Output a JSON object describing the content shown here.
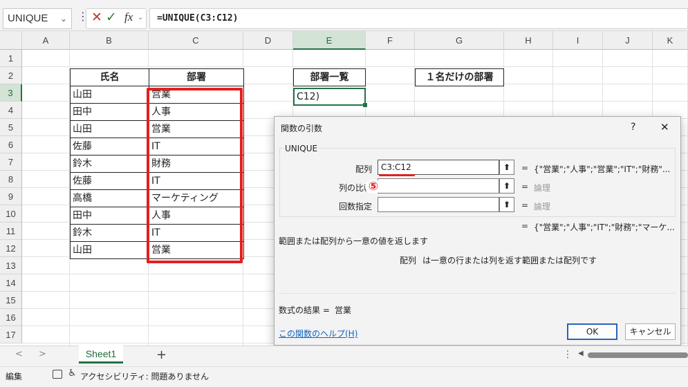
{
  "formula_bar": {
    "name_box": "UNIQUE",
    "chevron": "⌄",
    "more": "⋮",
    "cancel_icon": "✕",
    "enter_icon": "✓",
    "fx_icon": "fx",
    "fx_chevron": "⌄",
    "formula": "=UNIQUE(C3:C12)"
  },
  "columns": [
    "A",
    "B",
    "C",
    "D",
    "E",
    "F",
    "G",
    "H",
    "I",
    "J",
    "K"
  ],
  "rows": [
    "1",
    "2",
    "3",
    "4",
    "5",
    "6",
    "7",
    "8",
    "9",
    "10",
    "11",
    "12",
    "13",
    "14",
    "15",
    "16",
    "17"
  ],
  "table": {
    "headers": [
      "氏名",
      "部署"
    ],
    "names": [
      "山田",
      "田中",
      "山田",
      "佐藤",
      "鈴木",
      "佐藤",
      "高橋",
      "田中",
      "鈴木",
      "山田"
    ],
    "depts": [
      "営業",
      "人事",
      "営業",
      "IT",
      "財務",
      "IT",
      "マーケティング",
      "人事",
      "IT",
      "営業"
    ]
  },
  "e2_header": "部署一覧",
  "e3_value": "C12)",
  "g2_header": "１名だけの部署",
  "dialog": {
    "title": "関数の引数",
    "help_btn": "?",
    "close_btn": "✕",
    "function_name": "UNIQUE",
    "args": [
      {
        "label": "配列",
        "value": "C3:C12",
        "result": "{\"営業\";\"人事\";\"営業\";\"IT\";\"財務\"..."
      },
      {
        "label": "列の比較",
        "value": "",
        "result": "論理"
      },
      {
        "label": "回数指定",
        "value": "",
        "result": "論理"
      }
    ],
    "ref_icon": "⬆",
    "equals": "=",
    "overall_result": "{\"営業\";\"人事\";\"IT\";\"財務\";\"マーケ...",
    "description": "範囲または配列から一意の値を返します",
    "arg_help_label": "配列",
    "arg_help_text": "は一意の行または列を返す範囲または配列です",
    "formula_result_label": "数式の結果 =",
    "formula_result_value": "営業",
    "help_link": "この関数のヘルプ(H)",
    "ok": "OK",
    "cancel": "キャンセル"
  },
  "annotation_marker": "⑤",
  "sheet_tabs": {
    "prev": "<",
    "next": ">",
    "active": "Sheet1",
    "add": "+",
    "more": "⋮",
    "scroll_left": "◀"
  },
  "status": {
    "mode": "編集",
    "accessibility": "アクセシビリティ: 問題ありません"
  },
  "colors": {
    "accent_green": "#217346",
    "highlight_red": "#e02020",
    "link_blue": "#0b63c5"
  }
}
